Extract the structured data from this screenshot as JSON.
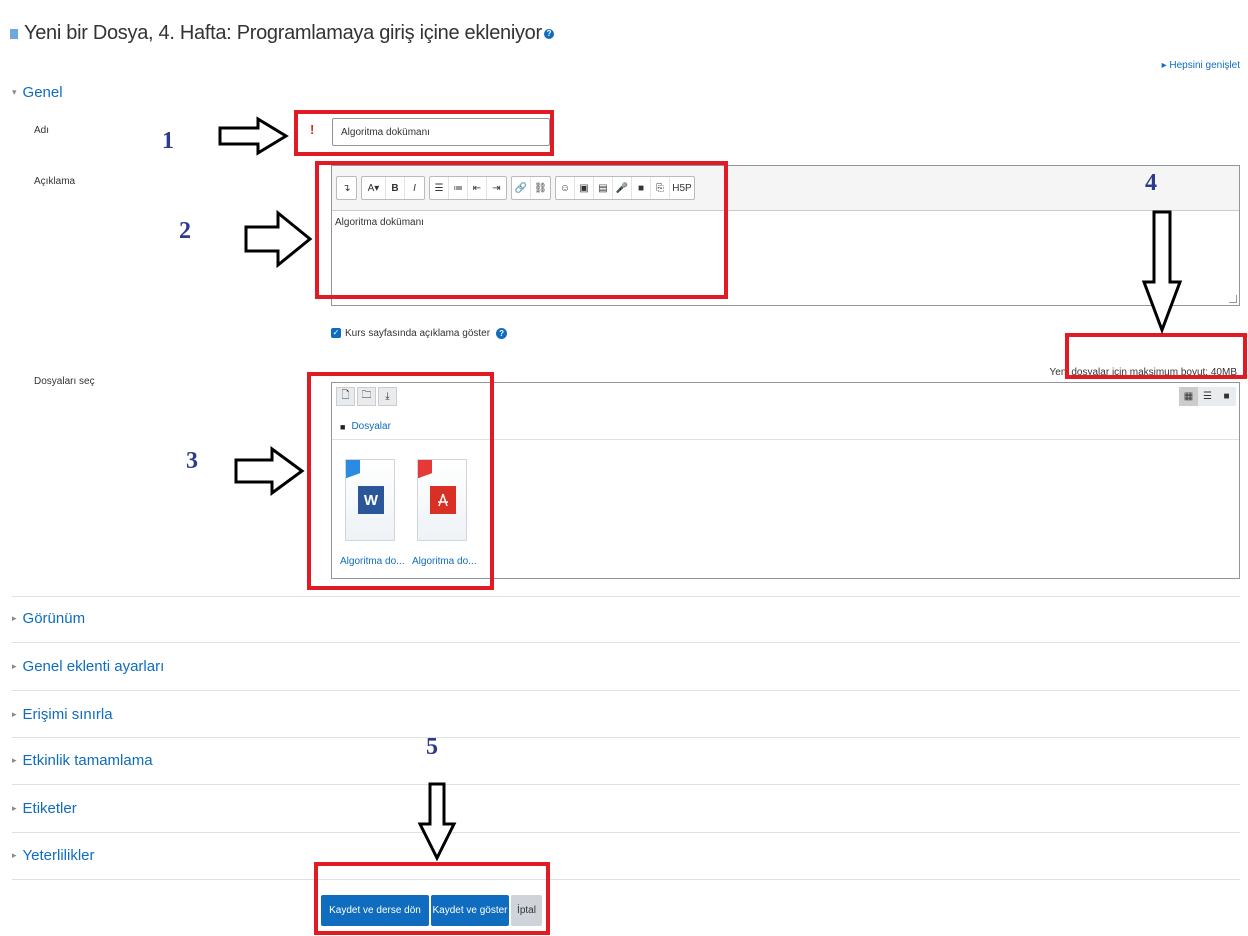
{
  "page": {
    "title": "Yeni bir Dosya, 4. Hafta: Programlamaya giriş içine ekleniyor",
    "expand_all": "Hepsini genişlet"
  },
  "sections": {
    "general": "Genel",
    "appearance": "Görünüm",
    "common_module_settings": "Genel eklenti ayarları",
    "restrict_access": "Erişimi sınırla",
    "activity_completion": "Etkinlik tamamlama",
    "tags": "Etiketler",
    "competencies": "Yeterlilikler"
  },
  "form": {
    "name_label": "Adı",
    "name_value": "Algoritma dokümanı",
    "required_icon": "!",
    "description_label": "Açıklama",
    "description_value": "Algoritma dokümanı",
    "show_description_label": "Kurs sayfasında açıklama göster",
    "show_description_checked": true,
    "select_files_label": "Dosyaları seç",
    "max_size_text": "Yeni dosyalar için maksimum boyut: 40MB",
    "folder_path": "Dosyalar",
    "files": [
      {
        "name": "Algoritma do...",
        "type": "word",
        "color": "#2b579a",
        "badge": "W"
      },
      {
        "name": "Algoritma do...",
        "type": "pdf",
        "color": "#d93025",
        "badge": ""
      }
    ]
  },
  "editor_toolbar": [
    [
      "↴"
    ],
    [
      "A▾",
      "B",
      "I"
    ],
    [
      "☰",
      "≔",
      "⇤",
      "⇥"
    ],
    [
      "🔗",
      "⛓"
    ],
    [
      "☺",
      "▣",
      "▤",
      "🎤",
      "■",
      "⎘",
      "H5P"
    ]
  ],
  "buttons": {
    "save_return": "Kaydet ve derse dön",
    "save_display": "Kaydet ve göster",
    "cancel": "İptal"
  },
  "annotations": {
    "n1": "1",
    "n2": "2",
    "n3": "3",
    "n4": "4",
    "n5": "5",
    "highlight_color": "#e01b24",
    "number_color": "#2e3a8c"
  },
  "colors": {
    "accent": "#0f6cbf",
    "required": "#ca3120"
  }
}
